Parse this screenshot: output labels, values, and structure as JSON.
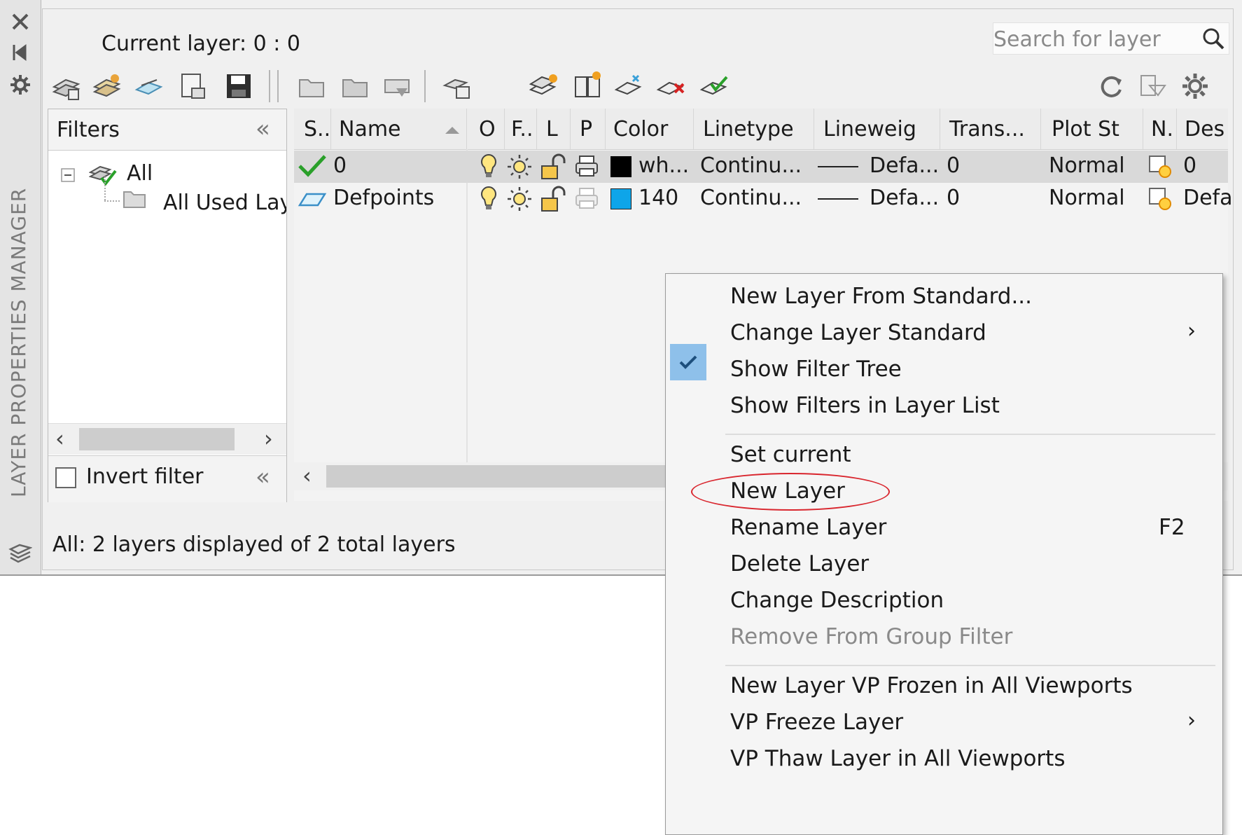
{
  "palette": {
    "side_title": "LAYER PROPERTIES MANAGER",
    "current_layer": "Current layer: 0 : 0",
    "search_placeholder": "Search for layer",
    "status": "All: 2 layers displayed of 2 total layers"
  },
  "toolbar": {
    "icons": [
      "new-property-filter-icon",
      "new-group-filter-icon",
      "layer-states-manager-icon",
      "import-layer-states-icon",
      "save-icon",
      "folder-icon",
      "folder-open-icon",
      "print-preview-icon",
      "layer-settings-icon",
      "new-layer-icon",
      "new-layer-vp-frozen-icon",
      "new-layer-vp-icon",
      "delete-layer-icon",
      "set-current-icon",
      "refresh-icon",
      "layer-preview-icon",
      "settings-gear-icon"
    ]
  },
  "filters": {
    "header": "Filters",
    "tree": [
      {
        "label": "All",
        "expanded": true
      },
      {
        "label": "All Used Lay"
      }
    ],
    "invert_label": "Invert filter",
    "invert_checked": false
  },
  "grid": {
    "columns": [
      "S..",
      "Name",
      "O",
      "F..",
      "L",
      "P",
      "Color",
      "Linetype",
      "Lineweig",
      "Trans...",
      "Plot St",
      "N.",
      "Des"
    ],
    "rows": [
      {
        "name": "0",
        "color_swatch": "#000000",
        "color": "wh...",
        "linetype": "Continu...",
        "lineweight": "Defa...",
        "transparency": "0",
        "plot_style": "Normal",
        "description": "0",
        "current": true
      },
      {
        "name": "Defpoints",
        "color_swatch": "#0ea5e9",
        "color": "140",
        "linetype": "Continu...",
        "lineweight": "Defa...",
        "transparency": "0",
        "plot_style": "Normal",
        "description": "Defa",
        "current": false
      }
    ]
  },
  "context_menu": {
    "items": [
      {
        "label": "New Layer From Standard..."
      },
      {
        "label": "Change Layer Standard",
        "submenu": true
      },
      {
        "label": "Show Filter Tree",
        "checked": true
      },
      {
        "label": "Show Filters in Layer List"
      },
      {
        "label": "Set current"
      },
      {
        "label": "New Layer",
        "highlighted": true
      },
      {
        "label": "Rename Layer",
        "shortcut": "F2"
      },
      {
        "label": "Delete Layer"
      },
      {
        "label": "Change Description"
      },
      {
        "label": "Remove From Group Filter",
        "disabled": true
      },
      {
        "label": "New Layer VP Frozen in All Viewports"
      },
      {
        "label": "VP Freeze Layer",
        "submenu": true
      },
      {
        "label": "VP Thaw Layer in All Viewports"
      }
    ],
    "submenu_glyph": "›",
    "accent": "#8ec0ea",
    "highlight_ring": "#d9262e"
  }
}
